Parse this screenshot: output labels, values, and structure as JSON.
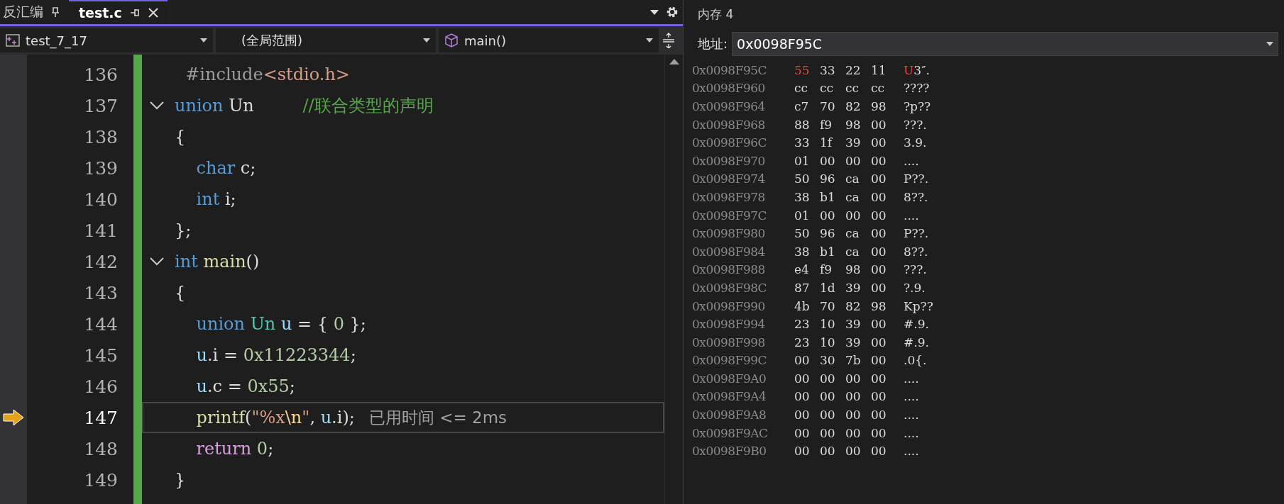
{
  "editor": {
    "tabs": [
      {
        "label": "反汇编",
        "selected": false
      },
      {
        "label": "test.c",
        "selected": true
      }
    ],
    "nav": {
      "project": "test_7_17",
      "scope": "(全局范围)",
      "member": "main()"
    },
    "lines": [
      {
        "number": "136",
        "current": false,
        "tokens": [
          {
            "t": "  #include",
            "kind": "preproc"
          },
          {
            "t": "<stdio.h>",
            "kind": "string"
          }
        ]
      },
      {
        "number": "137",
        "expanded": true,
        "current": false,
        "tokens": [
          {
            "t": "union",
            "kind": "keyword"
          },
          {
            "t": " Un",
            "kind": "plain"
          },
          {
            "t": "         //联合类型的声明",
            "kind": "comment"
          }
        ]
      },
      {
        "number": "138",
        "current": false,
        "tokens": [
          {
            "t": "{",
            "kind": "plain"
          }
        ]
      },
      {
        "number": "139",
        "current": false,
        "tokens": [
          {
            "t": "    char",
            "kind": "keyword"
          },
          {
            "t": " c;",
            "kind": "plain"
          }
        ]
      },
      {
        "number": "140",
        "current": false,
        "tokens": [
          {
            "t": "    int",
            "kind": "keyword"
          },
          {
            "t": " i;",
            "kind": "plain"
          }
        ]
      },
      {
        "number": "141",
        "current": false,
        "tokens": [
          {
            "t": "};",
            "kind": "plain"
          }
        ]
      },
      {
        "number": "142",
        "expanded": true,
        "current": false,
        "tokens": [
          {
            "t": "int",
            "kind": "keyword"
          },
          {
            "t": " main",
            "kind": "func"
          },
          {
            "t": "()",
            "kind": "plain"
          }
        ]
      },
      {
        "number": "143",
        "current": false,
        "tokens": [
          {
            "t": "{",
            "kind": "plain"
          }
        ]
      },
      {
        "number": "144",
        "current": false,
        "tokens": [
          {
            "t": "    union",
            "kind": "keyword"
          },
          {
            "t": " Un",
            "kind": "type"
          },
          {
            "t": " u",
            "kind": "var"
          },
          {
            "t": " = { ",
            "kind": "plain"
          },
          {
            "t": "0",
            "kind": "number"
          },
          {
            "t": " };",
            "kind": "plain"
          }
        ]
      },
      {
        "number": "145",
        "current": false,
        "tokens": [
          {
            "t": "    u",
            "kind": "var"
          },
          {
            "t": ".i = ",
            "kind": "plain"
          },
          {
            "t": "0x11223344",
            "kind": "number"
          },
          {
            "t": ";",
            "kind": "plain"
          }
        ]
      },
      {
        "number": "146",
        "current": false,
        "tokens": [
          {
            "t": "    u",
            "kind": "var"
          },
          {
            "t": ".c = ",
            "kind": "plain"
          },
          {
            "t": "0x55",
            "kind": "number"
          },
          {
            "t": ";",
            "kind": "plain"
          }
        ]
      },
      {
        "number": "147",
        "current": true,
        "hint": "已用时间 <= 2ms",
        "tokens": [
          {
            "t": "    printf",
            "kind": "func"
          },
          {
            "t": "(",
            "kind": "plain"
          },
          {
            "t": "\"%x",
            "kind": "string"
          },
          {
            "t": "\\n",
            "kind": "escape"
          },
          {
            "t": "\"",
            "kind": "string"
          },
          {
            "t": ", ",
            "kind": "plain"
          },
          {
            "t": "u",
            "kind": "var"
          },
          {
            "t": ".i);",
            "kind": "plain"
          }
        ]
      },
      {
        "number": "148",
        "current": false,
        "tokens": [
          {
            "t": "    return",
            "kind": "control"
          },
          {
            "t": " 0",
            "kind": "number"
          },
          {
            "t": ";",
            "kind": "plain"
          }
        ]
      },
      {
        "number": "149",
        "current": false,
        "tokens": [
          {
            "t": "}",
            "kind": "plain"
          }
        ]
      }
    ]
  },
  "memory": {
    "title": "内存 4",
    "address_label": "地址:",
    "address": "0x0098F95C",
    "rows": [
      {
        "address": "0x0098F95C",
        "bytes": [
          {
            "v": "55",
            "changed": true
          },
          {
            "v": "33",
            "changed": false
          },
          {
            "v": "22",
            "changed": false
          },
          {
            "v": "11",
            "changed": false
          }
        ],
        "ascii": [
          {
            "t": "U",
            "changed": true
          },
          {
            "t": "3″.",
            "changed": false
          }
        ]
      },
      {
        "address": "0x0098F960",
        "bytes": [
          {
            "v": "cc",
            "changed": false
          },
          {
            "v": "cc",
            "changed": false
          },
          {
            "v": "cc",
            "changed": false
          },
          {
            "v": "cc",
            "changed": false
          }
        ],
        "ascii": [
          {
            "t": "????",
            "changed": false
          }
        ]
      },
      {
        "address": "0x0098F964",
        "bytes": [
          {
            "v": "c7",
            "changed": false
          },
          {
            "v": "70",
            "changed": false
          },
          {
            "v": "82",
            "changed": false
          },
          {
            "v": "98",
            "changed": false
          }
        ],
        "ascii": [
          {
            "t": "?p??",
            "changed": false
          }
        ]
      },
      {
        "address": "0x0098F968",
        "bytes": [
          {
            "v": "88",
            "changed": false
          },
          {
            "v": "f9",
            "changed": false
          },
          {
            "v": "98",
            "changed": false
          },
          {
            "v": "00",
            "changed": false
          }
        ],
        "ascii": [
          {
            "t": "???.",
            "changed": false
          }
        ]
      },
      {
        "address": "0x0098F96C",
        "bytes": [
          {
            "v": "33",
            "changed": false
          },
          {
            "v": "1f",
            "changed": false
          },
          {
            "v": "39",
            "changed": false
          },
          {
            "v": "00",
            "changed": false
          }
        ],
        "ascii": [
          {
            "t": "3.9.",
            "changed": false
          }
        ]
      },
      {
        "address": "0x0098F970",
        "bytes": [
          {
            "v": "01",
            "changed": false
          },
          {
            "v": "00",
            "changed": false
          },
          {
            "v": "00",
            "changed": false
          },
          {
            "v": "00",
            "changed": false
          }
        ],
        "ascii": [
          {
            "t": "....",
            "changed": false
          }
        ]
      },
      {
        "address": "0x0098F974",
        "bytes": [
          {
            "v": "50",
            "changed": false
          },
          {
            "v": "96",
            "changed": false
          },
          {
            "v": "ca",
            "changed": false
          },
          {
            "v": "00",
            "changed": false
          }
        ],
        "ascii": [
          {
            "t": "P??.",
            "changed": false
          }
        ]
      },
      {
        "address": "0x0098F978",
        "bytes": [
          {
            "v": "38",
            "changed": false
          },
          {
            "v": "b1",
            "changed": false
          },
          {
            "v": "ca",
            "changed": false
          },
          {
            "v": "00",
            "changed": false
          }
        ],
        "ascii": [
          {
            "t": "8??.",
            "changed": false
          }
        ]
      },
      {
        "address": "0x0098F97C",
        "bytes": [
          {
            "v": "01",
            "changed": false
          },
          {
            "v": "00",
            "changed": false
          },
          {
            "v": "00",
            "changed": false
          },
          {
            "v": "00",
            "changed": false
          }
        ],
        "ascii": [
          {
            "t": "....",
            "changed": false
          }
        ]
      },
      {
        "address": "0x0098F980",
        "bytes": [
          {
            "v": "50",
            "changed": false
          },
          {
            "v": "96",
            "changed": false
          },
          {
            "v": "ca",
            "changed": false
          },
          {
            "v": "00",
            "changed": false
          }
        ],
        "ascii": [
          {
            "t": "P??.",
            "changed": false
          }
        ]
      },
      {
        "address": "0x0098F984",
        "bytes": [
          {
            "v": "38",
            "changed": false
          },
          {
            "v": "b1",
            "changed": false
          },
          {
            "v": "ca",
            "changed": false
          },
          {
            "v": "00",
            "changed": false
          }
        ],
        "ascii": [
          {
            "t": "8??.",
            "changed": false
          }
        ]
      },
      {
        "address": "0x0098F988",
        "bytes": [
          {
            "v": "e4",
            "changed": false
          },
          {
            "v": "f9",
            "changed": false
          },
          {
            "v": "98",
            "changed": false
          },
          {
            "v": "00",
            "changed": false
          }
        ],
        "ascii": [
          {
            "t": "???.",
            "changed": false
          }
        ]
      },
      {
        "address": "0x0098F98C",
        "bytes": [
          {
            "v": "87",
            "changed": false
          },
          {
            "v": "1d",
            "changed": false
          },
          {
            "v": "39",
            "changed": false
          },
          {
            "v": "00",
            "changed": false
          }
        ],
        "ascii": [
          {
            "t": "?.9.",
            "changed": false
          }
        ]
      },
      {
        "address": "0x0098F990",
        "bytes": [
          {
            "v": "4b",
            "changed": false
          },
          {
            "v": "70",
            "changed": false
          },
          {
            "v": "82",
            "changed": false
          },
          {
            "v": "98",
            "changed": false
          }
        ],
        "ascii": [
          {
            "t": "Kp??",
            "changed": false
          }
        ]
      },
      {
        "address": "0x0098F994",
        "bytes": [
          {
            "v": "23",
            "changed": false
          },
          {
            "v": "10",
            "changed": false
          },
          {
            "v": "39",
            "changed": false
          },
          {
            "v": "00",
            "changed": false
          }
        ],
        "ascii": [
          {
            "t": "#.9.",
            "changed": false
          }
        ]
      },
      {
        "address": "0x0098F998",
        "bytes": [
          {
            "v": "23",
            "changed": false
          },
          {
            "v": "10",
            "changed": false
          },
          {
            "v": "39",
            "changed": false
          },
          {
            "v": "00",
            "changed": false
          }
        ],
        "ascii": [
          {
            "t": "#.9.",
            "changed": false
          }
        ]
      },
      {
        "address": "0x0098F99C",
        "bytes": [
          {
            "v": "00",
            "changed": false
          },
          {
            "v": "30",
            "changed": false
          },
          {
            "v": "7b",
            "changed": false
          },
          {
            "v": "00",
            "changed": false
          }
        ],
        "ascii": [
          {
            "t": ".0{.",
            "changed": false
          }
        ]
      },
      {
        "address": "0x0098F9A0",
        "bytes": [
          {
            "v": "00",
            "changed": false
          },
          {
            "v": "00",
            "changed": false
          },
          {
            "v": "00",
            "changed": false
          },
          {
            "v": "00",
            "changed": false
          }
        ],
        "ascii": [
          {
            "t": "....",
            "changed": false
          }
        ]
      },
      {
        "address": "0x0098F9A4",
        "bytes": [
          {
            "v": "00",
            "changed": false
          },
          {
            "v": "00",
            "changed": false
          },
          {
            "v": "00",
            "changed": false
          },
          {
            "v": "00",
            "changed": false
          }
        ],
        "ascii": [
          {
            "t": "....",
            "changed": false
          }
        ]
      },
      {
        "address": "0x0098F9A8",
        "bytes": [
          {
            "v": "00",
            "changed": false
          },
          {
            "v": "00",
            "changed": false
          },
          {
            "v": "00",
            "changed": false
          },
          {
            "v": "00",
            "changed": false
          }
        ],
        "ascii": [
          {
            "t": "....",
            "changed": false
          }
        ]
      },
      {
        "address": "0x0098F9AC",
        "bytes": [
          {
            "v": "00",
            "changed": false
          },
          {
            "v": "00",
            "changed": false
          },
          {
            "v": "00",
            "changed": false
          },
          {
            "v": "00",
            "changed": false
          }
        ],
        "ascii": [
          {
            "t": "....",
            "changed": false
          }
        ]
      },
      {
        "address": "0x0098F9B0",
        "bytes": [
          {
            "v": "00",
            "changed": false
          },
          {
            "v": "00",
            "changed": false
          },
          {
            "v": "00",
            "changed": false
          },
          {
            "v": "00",
            "changed": false
          }
        ],
        "ascii": [
          {
            "t": "....",
            "changed": false
          }
        ]
      }
    ]
  }
}
